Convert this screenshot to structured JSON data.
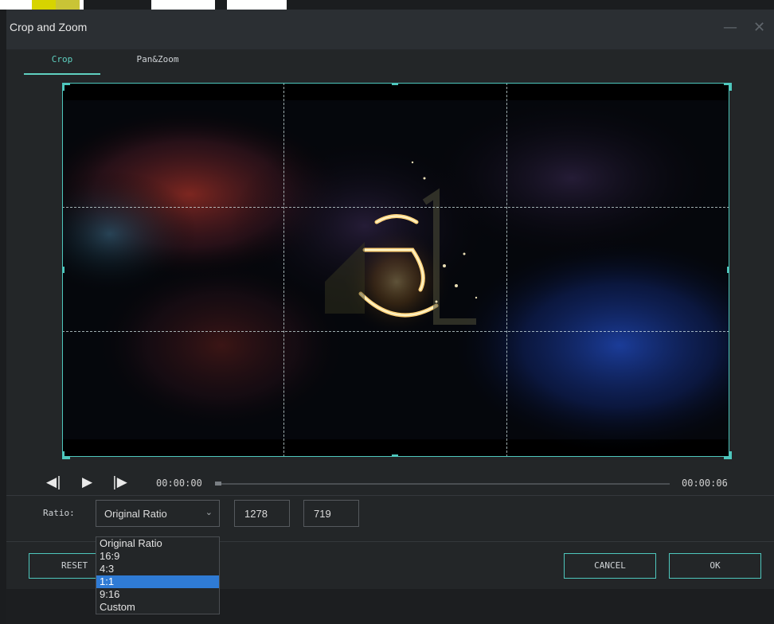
{
  "window": {
    "title": "Crop and Zoom",
    "minimize_glyph": "—",
    "close_glyph": "✕"
  },
  "tabs": [
    {
      "label": "Crop",
      "active": true
    },
    {
      "label": "Pan&Zoom",
      "active": false
    }
  ],
  "player": {
    "current_time": "00:00:00",
    "end_time": "00:00:06",
    "progress": 0
  },
  "ratio": {
    "label": "Ratio:",
    "selected": "Original Ratio",
    "width": "1278",
    "height": "719",
    "options": [
      "Original Ratio",
      "16:9",
      "4:3",
      "1:1",
      "9:16",
      "Custom"
    ],
    "highlighted_option": "1:1"
  },
  "buttons": {
    "reset": "RESET",
    "cancel": "CANCEL",
    "ok": "OK"
  },
  "icons": {
    "prev_frame": "prev-frame-icon",
    "play": "play-icon",
    "next_frame": "next-frame-icon",
    "dropdown": "chevron-down-icon"
  },
  "colors": {
    "accent": "#4ec7bd",
    "selection": "#2f7bd5",
    "background": "#232628"
  }
}
